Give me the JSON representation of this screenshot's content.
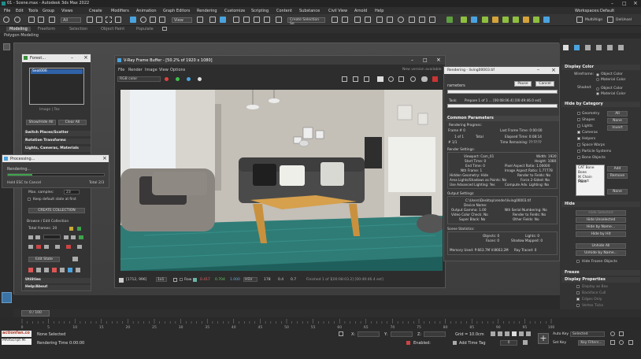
{
  "window": {
    "title": "01 - Scene.max - Autodesk 3ds Max 2022"
  },
  "menu": [
    "File",
    "Edit",
    "Tools",
    "Group",
    "Views",
    "Create",
    "Modifiers",
    "Animation",
    "Graph Editors",
    "Rendering",
    "Customize",
    "Scripting",
    "Content",
    "Substance",
    "Civil View",
    "Arnold",
    "Help"
  ],
  "workspaces": {
    "label": "Workspaces:",
    "value": "Default"
  },
  "toolbar": {
    "all_label": "All",
    "view_label": "View",
    "selection_set": "Create Selection Se",
    "multialign": "MultiAlign",
    "delunsel": "DelUnsel"
  },
  "ribbon": {
    "tabs": [
      "Modeling",
      "Freeform",
      "Selection",
      "Object Paint",
      "Populate"
    ],
    "sub": "Polygon Modeling"
  },
  "vfb": {
    "title": "V-Ray Frame Buffer - [50.2% of 1920 x 1080]",
    "menu": [
      "File",
      "Render",
      "Image",
      "View",
      "Options"
    ],
    "new_version": "New version available",
    "channel": "RGB color",
    "status": {
      "coords": "[1712, 996]",
      "mode": "1x1",
      "raw": "Raw",
      "r": "0.417",
      "g": "0.704",
      "b": "1.000",
      "space": "HSV",
      "h": "178",
      "s": "0.4",
      "v": "0.7",
      "finished": "Finished 1 of 1",
      "time": "[00:08:03.2] [00:49:46.4 est]"
    }
  },
  "render_panel": {
    "title": "Rendering - living00003.tif",
    "tab": "rameters",
    "pause": "Pause",
    "cancel": "Cancel",
    "task": "Task:",
    "task_value": "Prepare 1 of 1 ... [00:08:06.4] [00:49:46.0 est]",
    "common": "Common Parameters",
    "progress": "Rendering Progress:",
    "frame": "Frame #  0",
    "of": "1 of 1",
    "total": "Total",
    "last_frame_time": "Last Frame Time: 0:00:00",
    "elapsed": "Elapsed Time: 0:08:14",
    "remaining": "Time Remaining: ??:??:??",
    "frames": "# 1/1",
    "render_settings": "Render Settings:",
    "settings_rows": [
      "Viewport: Cam_01",
      "Start Time: 0",
      "End Time: 0",
      "Nth Frame: 1",
      "Hidden Geometry: Hide",
      "Area Lights/Shadows as Points: No",
      "Force 2-Sided: No",
      "Use Advanced Lighting: Yes"
    ],
    "settings_rows2": [
      "Width: 1920",
      "Height: 1080",
      "Pixel Aspect Ratio: 1.00000",
      "Image Aspect Ratio: 1.77778",
      "Render to Fields: No",
      "Force 2-Sided: No",
      "Compute Adv. Lighting: No"
    ],
    "output_settings": "Output Settings:",
    "output_file": "C:\\Users\\Desktop\\render\\living00003.tif",
    "output_rows": [
      "Device Name:",
      "Output Gamma: 1.00",
      "Video Color Check: No",
      "Super Black: No"
    ],
    "output_rows2": [
      "Nth Serial Numbering: No",
      "Render to Fields: No",
      "Other Fields: No",
      "Other Fields Checked: No"
    ],
    "scene_stats": "Scene Statistics:",
    "stats_rows": [
      "Objects: 0",
      "Faces: 0",
      "Lights: 0",
      "Memory Used: P:663.7M V:8663.2M"
    ],
    "stats_rows2": [
      "Lights: 0",
      "Shadow Mapped: 0",
      "Ray Traced: 0"
    ]
  },
  "fwin": {
    "title": "Forest...",
    "list_item": "Seat006",
    "image_label": "Image | Tex",
    "show_hide": "Show/Hide All",
    "clear_all": "Clear All",
    "rollouts": [
      "Switch Places/Scatter",
      "Rotation Transforms",
      "Lights, Cameras, Materials"
    ],
    "max_samples": "Max. samples:",
    "max_samples_val": "23",
    "keep_state": "Keep default state at first",
    "create_collection": "CREATE COLLECTION",
    "browse": "Browse / Edit Collection",
    "total_frames": "Total frames: 20",
    "edit_state": "Edit State",
    "utilities": "Utilities",
    "help": "Help/About"
  },
  "processing": {
    "title": "Processing...",
    "label": "Rendering...",
    "hold": "Hold ESC to Cancel",
    "total": "Total 2/3"
  },
  "cmdpanel": {
    "display_color": "Display Color",
    "wireframe": "Wireframe:",
    "object_color": "Object Color",
    "material_color": "Material Color",
    "shaded": "Shaded:",
    "hide_by_category": "Hide by Category",
    "categories": [
      "Geometry",
      "Shapes",
      "Lights",
      "Cameras",
      "Helpers",
      "Space Warps",
      "Particle Systems",
      "Bone Objects"
    ],
    "all": "All",
    "none": "None",
    "invert": "Invert",
    "list": [
      "CAT Bone",
      "Bone",
      "IK Chain Object",
      "Point"
    ],
    "add": "Add",
    "remove": "Remove",
    "none2": "None",
    "hide": "Hide",
    "hide_buttons": [
      "Hide Selected",
      "Hide Unselected",
      "Hide by Name...",
      "Hide by Hit",
      "Unhide All",
      "Unhide by Name...",
      "Hide Frozen Objects"
    ],
    "freeze": "Freeze",
    "display_properties": "Display Properties",
    "dp_rows": [
      "Display as Box",
      "Backface Cull",
      "Edges Only",
      "Vertex Ticks"
    ]
  },
  "timeline": {
    "frame": "0 / 100",
    "ticks": [
      "0",
      "5",
      "10",
      "15",
      "20",
      "25",
      "30",
      "35",
      "40",
      "45",
      "50",
      "55",
      "60",
      "65",
      "70",
      "75",
      "80",
      "85",
      "90",
      "95",
      "100"
    ]
  },
  "status": {
    "maxscript": "MAXScript Mi",
    "site": "actionfan.co",
    "selected": "None Selected",
    "render_time": "Rendering Time 0:00:00",
    "x_label": "X:",
    "y_label": "Y:",
    "z_label": "Z:",
    "grid": "Grid = 10.0cm",
    "enabled": "Enabled:",
    "add_time_tag": "Add Time Tag",
    "auto_key": "Auto Key",
    "selected_dd": "Selected",
    "set_key": "Set Key",
    "key_filters": "Key Filters...",
    "frame_val": "0"
  },
  "colors": {
    "accent": "#4aa3df",
    "teal": "#2f7c77",
    "ui_bg": "#2b2b2b",
    "progress_green": "#3fa34d"
  }
}
